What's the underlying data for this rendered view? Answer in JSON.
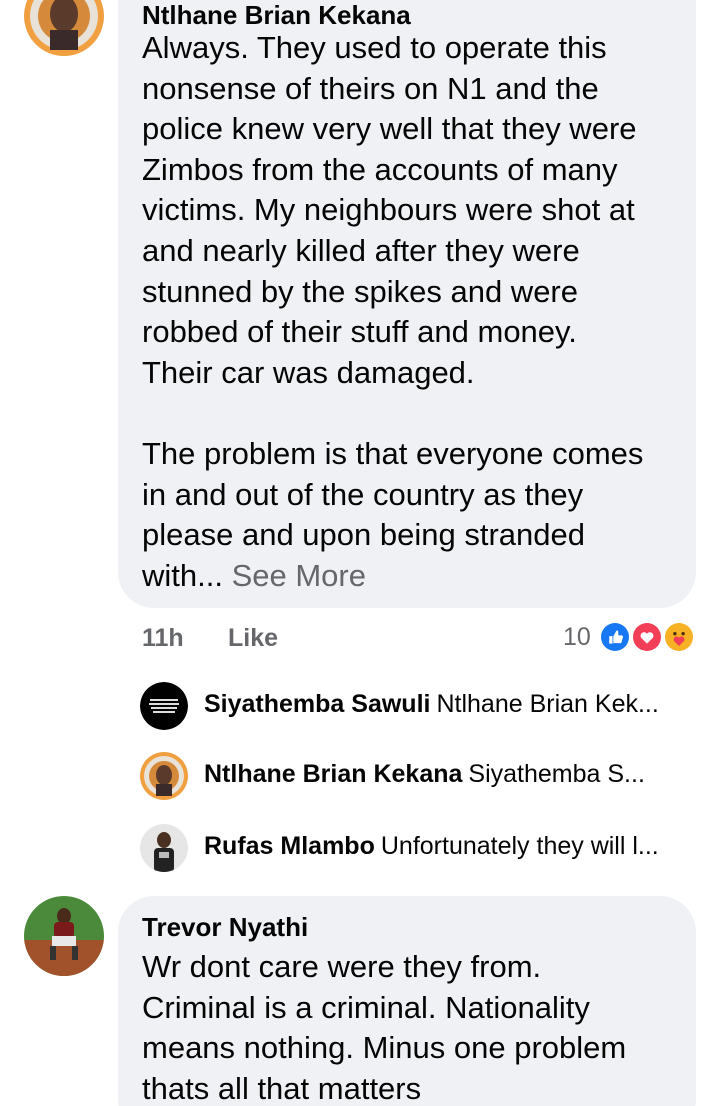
{
  "comments": [
    {
      "author": "Ntlhane Brian Kekana",
      "text": "Always. They used to operate this\nnonsense of theirs on N1 and the\npolice knew very well that they were\nZimbos from the accounts of many\nvictims. My neighbours were shot at\nand nearly killed after they were\nstunned by the spikes and were\nrobbed of their stuff and money.\nTheir car was damaged.\n\nThe problem is that everyone comes\nin and out of the country as they\nplease and upon being stranded\nwith...",
      "see_more": " See More",
      "time": "11h",
      "like_label": "Like",
      "reaction_count": "10",
      "reaction_icons": [
        "like-icon",
        "love-icon",
        "care-icon"
      ]
    },
    {
      "author": "Trevor Nyathi",
      "text": "Wr dont care were they from.\nCriminal is a criminal. Nationality\nmeans nothing. Minus one problem\nthats all that matters"
    }
  ],
  "replies": [
    {
      "name": "Siyathemba Sawuli",
      "text": "Ntlhane Brian Kek..."
    },
    {
      "name": "Ntlhane Brian Kekana",
      "text": "Siyathemba S..."
    },
    {
      "name": "Rufas Mlambo",
      "text": "Unfortunately they will l..."
    }
  ],
  "colors": {
    "bubble": "#eff1f4",
    "meta": "#65676b",
    "like": "#1877f2",
    "love": "#f33e58",
    "care": "#f7b125"
  }
}
